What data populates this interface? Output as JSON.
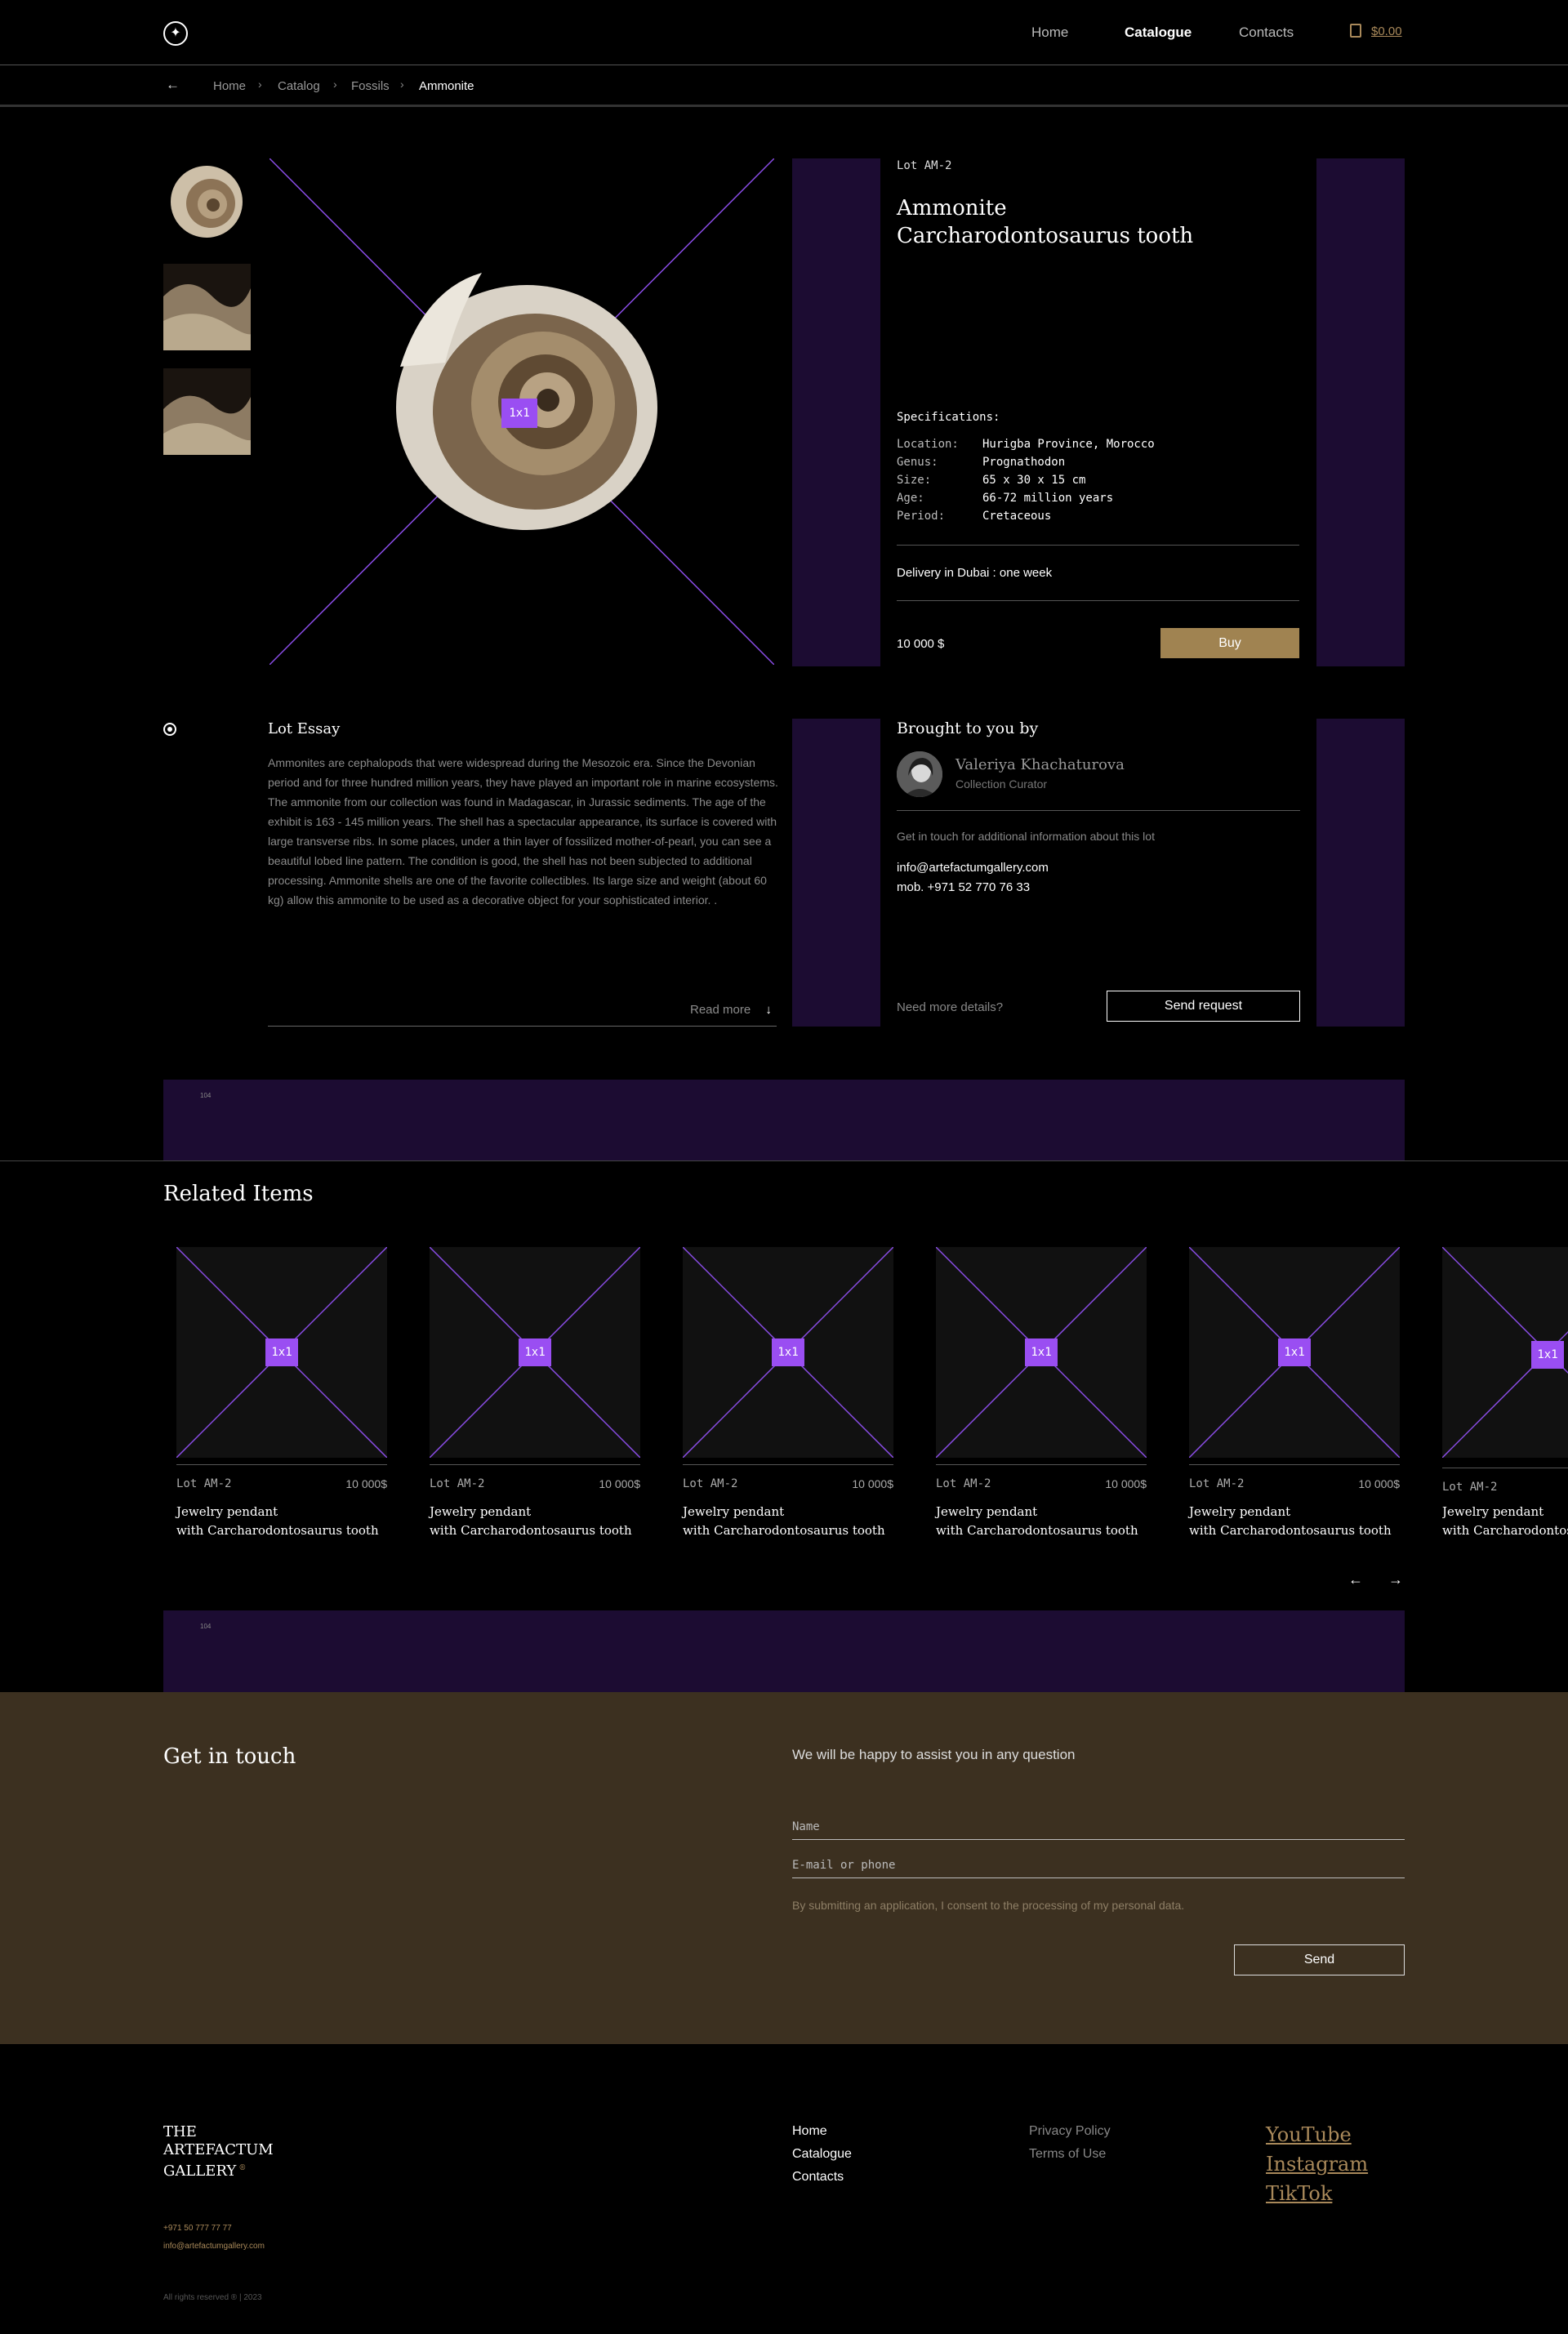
{
  "header": {
    "nav": [
      "Home",
      "Catalogue",
      "Contacts"
    ],
    "cart_total": "$0.00"
  },
  "breadcrumb": {
    "back": "←",
    "items": [
      "Home",
      "Catalog",
      "Fossils",
      "Ammonite"
    ],
    "separator": "›"
  },
  "product": {
    "placeholder_label": "1x1",
    "lot": "Lot AM-2",
    "title_line1": "Ammonite",
    "title_line2": "Carcharodontosaurus tooth",
    "specs_heading": "Specifications:",
    "specs": [
      {
        "label": "Location:",
        "value": "Hurigba Province, Morocco"
      },
      {
        "label": "Genus:",
        "value": "Prognathodon"
      },
      {
        "label": "Size:",
        "value": "65 x 30 x 15 cm"
      },
      {
        "label": "Age:",
        "value": "66-72 million years"
      },
      {
        "label": "Period:",
        "value": "Cretaceous"
      }
    ],
    "delivery": "Delivery in Dubai : one week",
    "price": "10 000 $",
    "buy_label": "Buy"
  },
  "essay": {
    "title": "Lot Essay",
    "text": "Ammonites are cephalopods that were widespread during the Mesozoic era. Since the Devonian period and for three hundred million years, they have played an important role in marine ecosystems. The ammonite from our collection was found in Madagascar, in Jurassic sediments. The age of the exhibit is 163 - 145 million years. The shell has a spectacular appearance, its surface is covered with large transverse ribs. In some places, under a thin layer of fossilized mother-of-pearl, you can see a beautiful lobed line pattern. The condition is good, the shell has not been subjected to additional processing. Ammonite shells are one of the favorite collectibles. Its large size and weight (about 60 kg) allow this ammonite to be used as a decorative object for your sophisticated interior. .",
    "read_more": "Read more",
    "read_more_arrow": "↓"
  },
  "curator": {
    "heading": "Brought to you by",
    "name": "Valeriya Khachaturova",
    "role": "Collection Curator",
    "note": "Get in touch for additional information about this lot",
    "email": "info@artefactumgallery.com",
    "phone": "mob. +971 52 770 76 33",
    "need_more": "Need more details?",
    "send_request": "Send request"
  },
  "banners": [
    "104",
    "104"
  ],
  "related": {
    "title": "Related Items",
    "placeholder_label": "1x1",
    "items": [
      {
        "lot": "Lot AM-2",
        "price": "10 000$",
        "name_line1": "Jewelry pendant",
        "name_line2": "with Carcharodontosaurus tooth"
      },
      {
        "lot": "Lot AM-2",
        "price": "10 000$",
        "name_line1": "Jewelry pendant",
        "name_line2": "with Carcharodontosaurus tooth"
      },
      {
        "lot": "Lot AM-2",
        "price": "10 000$",
        "name_line1": "Jewelry pendant",
        "name_line2": "with Carcharodontosaurus tooth"
      },
      {
        "lot": "Lot AM-2",
        "price": "10 000$",
        "name_line1": "Jewelry pendant",
        "name_line2": "with Carcharodontosaurus tooth"
      },
      {
        "lot": "Lot AM-2",
        "price": "10 000$",
        "name_line1": "Jewelry pendant",
        "name_line2": "with Carcharodontosaurus tooth"
      },
      {
        "lot": "Lot AM-2",
        "price": "",
        "name_line1": "Jewelry pendant",
        "name_line2": "with Carcharodontosaurus tooth"
      }
    ],
    "prev": "←",
    "next": "→"
  },
  "touch": {
    "title": "Get in touch",
    "subtitle": "We will be happy to assist you in any question",
    "name_placeholder": "Name",
    "contact_placeholder": "E-mail or phone",
    "consent": "By submitting an application, I consent to the processing of my personal data.",
    "send": "Send"
  },
  "footer": {
    "brand_line1": "THE",
    "brand_line2": "ARTEFACTUM",
    "brand_line3": "GALLERY",
    "brand_mark": "®",
    "phone": "+971 50 777 77 77",
    "email": "info@artefactumgallery.com",
    "copyright": "All rights reserved ® | 2023",
    "nav": [
      "Home",
      "Catalogue",
      "Contacts"
    ],
    "legal": [
      "Privacy Policy",
      "Terms of Use"
    ],
    "social": [
      "YouTube",
      "Instagram",
      "TikTok"
    ]
  },
  "colors": {
    "accent_gold": "#a08351",
    "accent_purple": "#9a4ef2",
    "panel_purple": "#1c0c32",
    "touch_brown": "#3c3020"
  }
}
